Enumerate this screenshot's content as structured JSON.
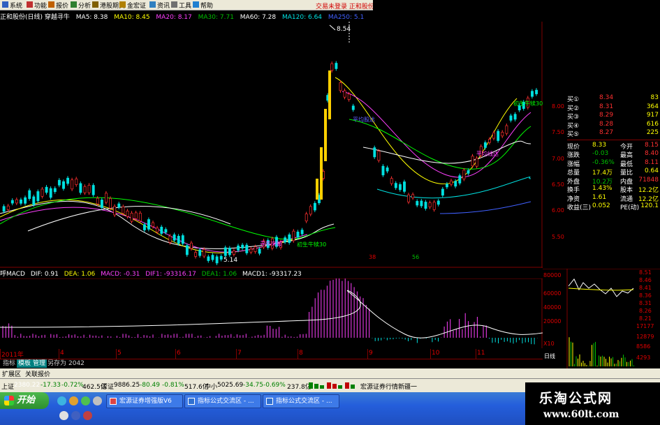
{
  "menu": {
    "items": [
      {
        "label": "系统",
        "icon": "system-icon"
      },
      {
        "label": "功能",
        "icon": "function-icon"
      },
      {
        "label": "报价",
        "icon": "quote-icon"
      },
      {
        "label": "分析",
        "icon": "analysis-icon"
      },
      {
        "label": "港股期货",
        "icon": "futures-icon"
      },
      {
        "label": "金宏证",
        "icon": "jinhong-icon"
      },
      {
        "label": "资讯",
        "icon": "info-icon"
      },
      {
        "label": "工具",
        "icon": "tool-icon"
      },
      {
        "label": "帮助",
        "icon": "help-icon"
      }
    ],
    "login": "交易未登录",
    "broker": "正和股份"
  },
  "chart_title": {
    "stock": "正和股份(日线) 穿越寻牛",
    "ma5": "MA5: 8.38",
    "ma10": "MA10: 8.45",
    "ma20": "MA20: 8.17",
    "ma30": "MA30: 7.71",
    "ma60": "MA60: 7.28",
    "ma120": "MA120: 6.64",
    "ma250": "MA250: 5.1"
  },
  "chart_annotations": {
    "high_label": "8.54",
    "low_label": "5.14",
    "buy_signal_left": "初生牛犊30",
    "buy_signal_right": "初生牛犊30",
    "mid_label_a": "平均股达",
    "mid_label_b": "寻牛突破",
    "mid_label_c": "平均线达",
    "count_a": "38",
    "count_b": "56"
  },
  "price_axis": [
    "8.00",
    "7.50",
    "7.00",
    "6.50",
    "6.00",
    "5.50"
  ],
  "macd_title": {
    "name": "呼MACD",
    "dif": "DIF: 0.91",
    "dea": "DEA: 1.06",
    "macd": "MACD: -0.31",
    "dif1": "DIF1: -93316.17",
    "dea1": "DEA1: 1.06",
    "macd1": "MACD1: -93317.23"
  },
  "date_axis": [
    "2011年",
    "4",
    "5",
    "6",
    "7",
    "8",
    "9",
    "10",
    "11"
  ],
  "bottom_tabs": [
    {
      "label": "指标",
      "active": false
    },
    {
      "label": "模板",
      "active": true
    },
    {
      "label": "管理",
      "active": true
    },
    {
      "label": "另存为",
      "active": false
    },
    {
      "label": "2042",
      "active": false
    }
  ],
  "ext_row": {
    "a": "扩展区",
    "b": "关联报价"
  },
  "status": {
    "sh_name": "上证",
    "sh_val": "2380.22",
    "sh_chg": "-17.33",
    "sh_pct": "-0.72%",
    "sh_amt": "462.5亿",
    "sz_name": "深证",
    "sz_val": "9886.25",
    "sz_chg": "-80.49",
    "sz_pct": "-0.81%",
    "sz_amt": "517.6亿",
    "zx_name": "中小",
    "zx_val": "5025.69",
    "zx_chg": "-34.75",
    "zx_pct": "-0.69%",
    "zx_amt": "237.8亿",
    "news": "宏源证券行情新疆一"
  },
  "quote": {
    "rows": [
      {
        "label": "买①",
        "price": "8.34",
        "vol": "83"
      },
      {
        "label": "买②",
        "price": "8.31",
        "vol": "364"
      },
      {
        "label": "买③",
        "price": "8.29",
        "vol": "917"
      },
      {
        "label": "买④",
        "price": "8.28",
        "vol": "616"
      },
      {
        "label": "买⑤",
        "price": "8.27",
        "vol": "225"
      }
    ],
    "stats": [
      {
        "k1": "现价",
        "v1": "8.33",
        "k2": "今开",
        "v2": "8.15"
      },
      {
        "k1": "涨跌",
        "v1": "-0.03",
        "k2": "最高",
        "v2": "8.40"
      },
      {
        "k1": "涨幅",
        "v1": "-0.36%",
        "k2": "最低",
        "v2": "8.11"
      },
      {
        "k1": "总量",
        "v1": "17.4万",
        "k2": "量比",
        "v2": "0.64"
      },
      {
        "k1": "外盘",
        "v1": "10.2万",
        "k2": "内盘",
        "v2": "71848"
      },
      {
        "k1": "换手",
        "v1": "1.43%",
        "k2": "股本",
        "v2": "12.2亿"
      },
      {
        "k1": "净资",
        "v1": "1.61",
        "k2": "流通",
        "v2": "12.2亿"
      },
      {
        "k1": "收益(三)",
        "v1": "0.052",
        "k2": "PE(动)",
        "v2": "120.1"
      }
    ]
  },
  "mini": {
    "vol_ticks": [
      "80000",
      "60000",
      "40000",
      "20000",
      "X10"
    ],
    "price_ticks": [
      "8.51",
      "8.46",
      "8.41",
      "8.36",
      "8.31",
      "8.26",
      "8.21"
    ],
    "vol_right": [
      "17177",
      "12879",
      "8586",
      "4293"
    ],
    "tab_day": "日线"
  },
  "right_tabs": [
    "笔",
    "价",
    "细",
    "势",
    "联",
    "值"
  ],
  "taskbar": {
    "start": "开始",
    "tasks": [
      "宏源证券增强版V6",
      "指标公式交流区 - ...",
      "指标公式交流区 - ..."
    ]
  },
  "watermark": {
    "line1": "乐淘公式网",
    "line2": "www.60lt.com"
  }
}
